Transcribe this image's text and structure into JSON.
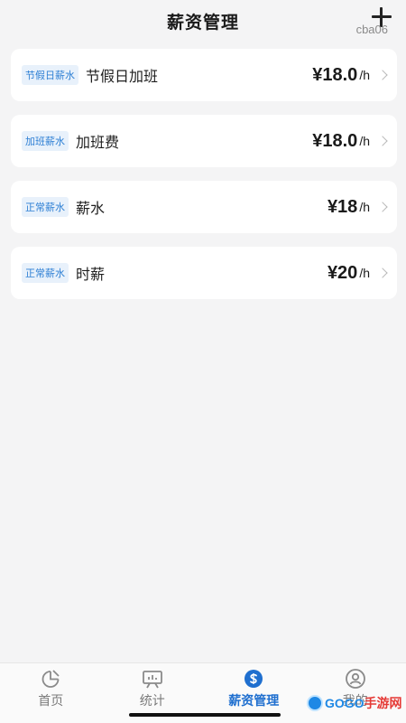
{
  "header": {
    "title": "薪资管理",
    "user_tag": "cba06",
    "add_icon": "plus-icon"
  },
  "salary_items": [
    {
      "badge": "节假日薪水",
      "name": "节假日加班",
      "amount": "¥18.0",
      "unit": "/h"
    },
    {
      "badge": "加班薪水",
      "name": "加班费",
      "amount": "¥18.0",
      "unit": "/h"
    },
    {
      "badge": "正常薪水",
      "name": "薪水",
      "amount": "¥18",
      "unit": "/h"
    },
    {
      "badge": "正常薪水",
      "name": "时薪",
      "amount": "¥20",
      "unit": "/h"
    }
  ],
  "tabbar": {
    "tabs": [
      {
        "label": "首页",
        "icon": "home-chart-icon",
        "active": false
      },
      {
        "label": "统计",
        "icon": "statistics-icon",
        "active": false
      },
      {
        "label": "薪资管理",
        "icon": "salary-icon",
        "active": true
      },
      {
        "label": "我的",
        "icon": "profile-icon",
        "active": false
      }
    ]
  },
  "colors": {
    "accent": "#1f6fcf",
    "badge_bg": "#e8f1fb",
    "badge_text": "#2d7fd4",
    "page_bg": "#f4f4f5"
  },
  "watermark": {
    "text": "GOGO",
    "cn": "手游网"
  }
}
